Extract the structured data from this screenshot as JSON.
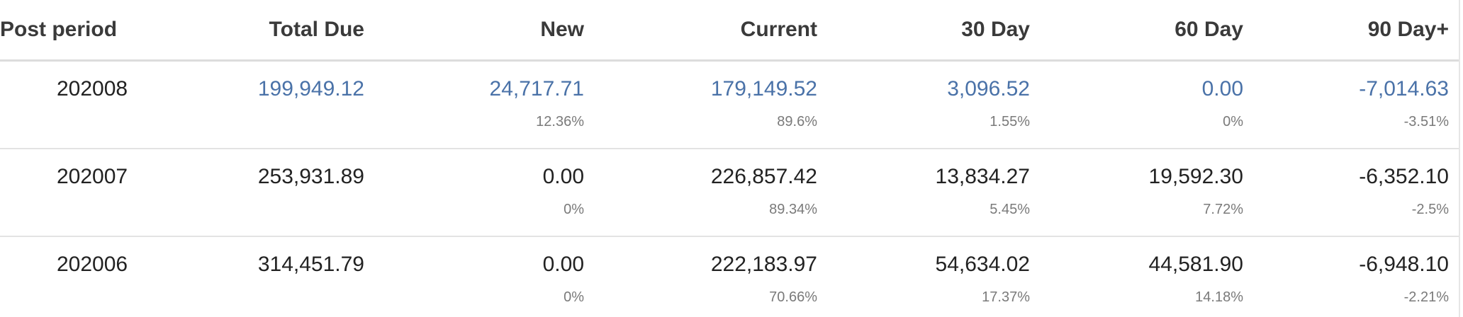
{
  "table": {
    "headers": [
      "Post period",
      "Total Due",
      "New",
      "Current",
      "30 Day",
      "60 Day",
      "90 Day+"
    ],
    "rows": [
      {
        "period": "202008",
        "linked": true,
        "total_due": "199,949.12",
        "new": "24,717.71",
        "new_pct": "12.36%",
        "current": "179,149.52",
        "current_pct": "89.6%",
        "day30": "3,096.52",
        "day30_pct": "1.55%",
        "day60": "0.00",
        "day60_pct": "0%",
        "day90": "-7,014.63",
        "day90_pct": "-3.51%"
      },
      {
        "period": "202007",
        "linked": false,
        "total_due": "253,931.89",
        "new": "0.00",
        "new_pct": "0%",
        "current": "226,857.42",
        "current_pct": "89.34%",
        "day30": "13,834.27",
        "day30_pct": "5.45%",
        "day60": "19,592.30",
        "day60_pct": "7.72%",
        "day90": "-6,352.10",
        "day90_pct": "-2.5%"
      },
      {
        "period": "202006",
        "linked": false,
        "total_due": "314,451.79",
        "new": "0.00",
        "new_pct": "0%",
        "current": "222,183.97",
        "current_pct": "70.66%",
        "day30": "54,634.02",
        "day30_pct": "17.37%",
        "day60": "44,581.90",
        "day60_pct": "14.18%",
        "day90": "-6,948.10",
        "day90_pct": "-2.21%"
      }
    ]
  },
  "colors": {
    "link": "#4a72a8",
    "text": "#222222",
    "header_text": "#3a3a3a",
    "percent_text": "#7a7a7a",
    "row_border": "#e3e3e3"
  }
}
